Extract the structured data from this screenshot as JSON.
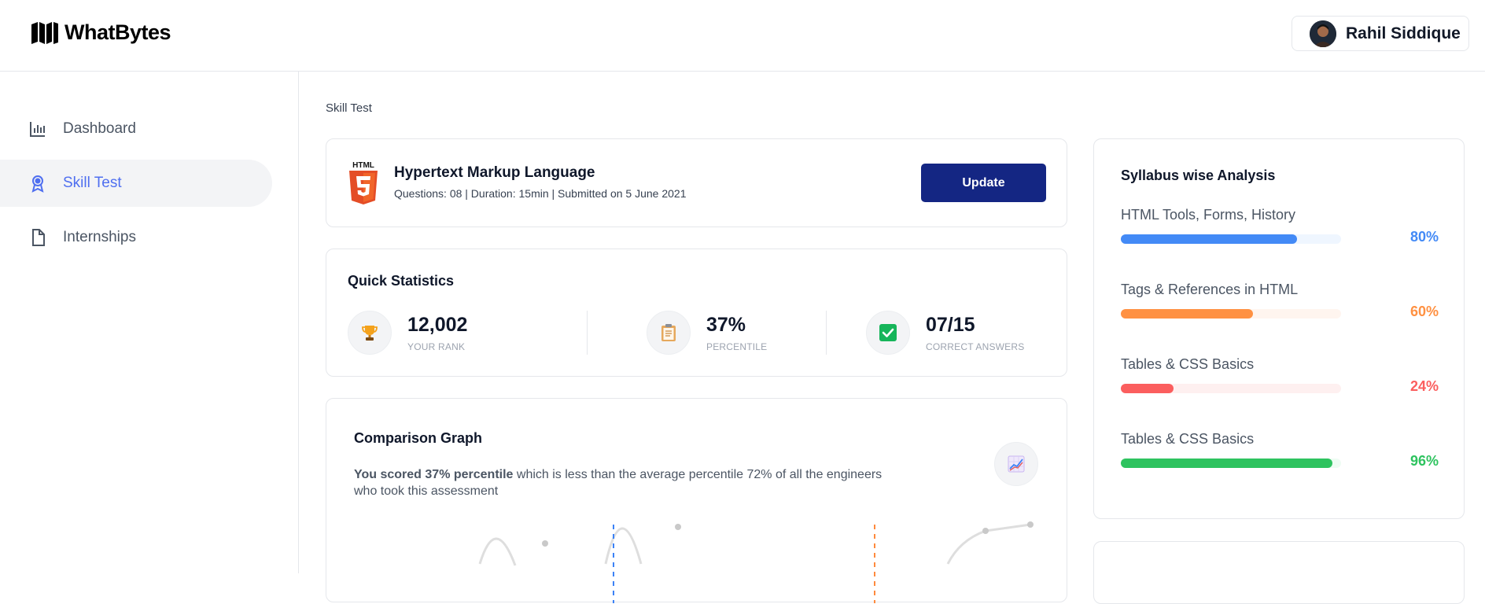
{
  "brand": {
    "name": "WhatBytes"
  },
  "user": {
    "name": "Rahil Siddique"
  },
  "sidebar": {
    "items": [
      {
        "label": "Dashboard",
        "icon": "bar-chart-icon",
        "active": false
      },
      {
        "label": "Skill Test",
        "icon": "award-icon",
        "active": true
      },
      {
        "label": "Internships",
        "icon": "document-icon",
        "active": false
      }
    ]
  },
  "breadcrumb": "Skill Test",
  "test": {
    "badge_text": "HTML",
    "title": "Hypertext Markup Language",
    "meta": "Questions: 08 | Duration: 15min | Submitted on 5 June 2021",
    "update_label": "Update"
  },
  "stats": {
    "title": "Quick Statistics",
    "items": [
      {
        "value": "12,002",
        "label": "YOUR RANK",
        "icon": "trophy-icon"
      },
      {
        "value": "37%",
        "label": "PERCENTILE",
        "icon": "clipboard-icon"
      },
      {
        "value": "07/15",
        "label": "CORRECT ANSWERS",
        "icon": "checkbox-icon"
      }
    ]
  },
  "graph": {
    "title": "Comparison Graph",
    "desc_bold": "You scored 37% percentile",
    "desc_rest": " which is less than the average percentile 72% of all the engineers who took this assessment",
    "icon": "line-chart-icon"
  },
  "syllabus": {
    "title": "Syllabus wise Analysis",
    "items": [
      {
        "label": "HTML Tools, Forms, History",
        "value": 80,
        "pct": "80%",
        "color": "#438af6",
        "track": "#eff6ff"
      },
      {
        "label": "Tags & References in HTML",
        "value": 60,
        "pct": "60%",
        "color": "#ff9142",
        "track": "#fff5ef"
      },
      {
        "label": "Tables & CSS Basics",
        "value": 24,
        "pct": "24%",
        "color": "#fb5e5e",
        "track": "#fef0f0"
      },
      {
        "label": "Tables & CSS Basics",
        "value": 96,
        "pct": "96%",
        "color": "#2ec35f",
        "track": "#eefcf3"
      }
    ]
  },
  "colors": {
    "accent": "#4f6ff0",
    "button": "#142683",
    "html_orange": "#e44d26"
  }
}
